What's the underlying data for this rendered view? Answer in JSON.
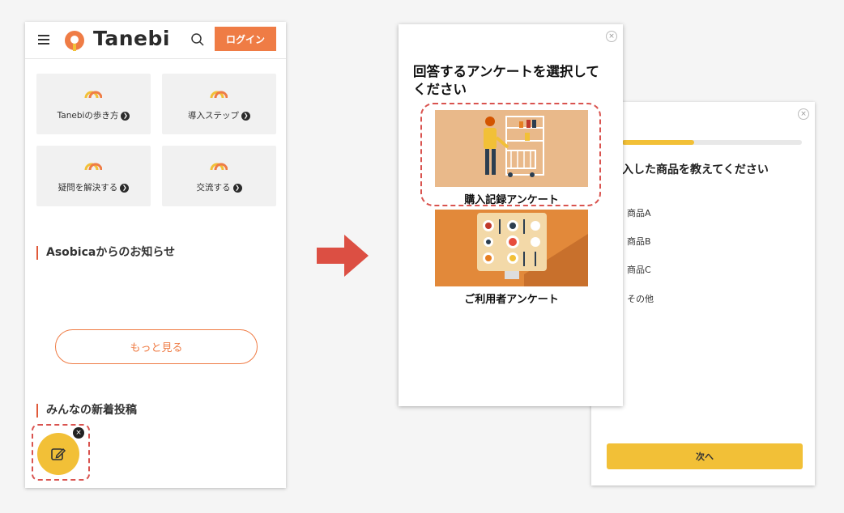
{
  "home": {
    "logo_text": "Tanebi",
    "login_label": "ログイン",
    "tiles": [
      {
        "label": "Tanebiの歩き方"
      },
      {
        "label": "導入ステップ"
      },
      {
        "label": "疑問を解決する"
      },
      {
        "label": "交流する"
      }
    ],
    "news_title": "Asobicaからのお知らせ",
    "more_label": "もっと見る",
    "posts_title": "みんなの新着投稿"
  },
  "survey_select": {
    "title": "回答するアンケートを選択してください",
    "options": [
      {
        "label": "購入記録アンケート"
      },
      {
        "label": "ご利用者アンケート"
      }
    ]
  },
  "question": {
    "progress": 0.4,
    "title": "入した商品を教えてください",
    "options": [
      "商品A",
      "商品B",
      "商品C",
      "その他"
    ],
    "next_label": "次へ"
  },
  "colors": {
    "brand_orange": "#ef7c45",
    "accent_yellow": "#f2c037",
    "highlight_red": "#d9534f"
  },
  "icons": {
    "close": "×",
    "tile_arrow": "❯"
  }
}
